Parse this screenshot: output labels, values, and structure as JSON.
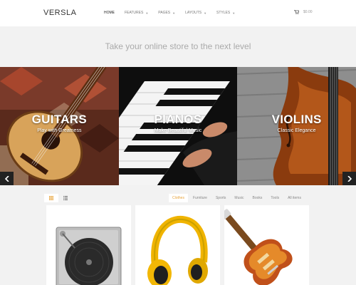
{
  "header": {
    "logo": "VERSLA",
    "nav": [
      {
        "label": "HOME",
        "active": true,
        "dropdown": false
      },
      {
        "label": "FEATURES",
        "active": false,
        "dropdown": true
      },
      {
        "label": "PAGES",
        "active": false,
        "dropdown": true
      },
      {
        "label": "LAYOUTS",
        "active": false,
        "dropdown": true
      },
      {
        "label": "STYLES",
        "active": false,
        "dropdown": true
      }
    ],
    "cart_total": "$0.00"
  },
  "tagline": "Take your online store to the next level",
  "hero": {
    "panels": [
      {
        "title": "GUITARS",
        "subtitle": "Play with Greatness"
      },
      {
        "title": "PIANOS",
        "subtitle": "Make Beautiful Music"
      },
      {
        "title": "VIOLINS",
        "subtitle": "Classic Elegance"
      }
    ]
  },
  "filters": {
    "items": [
      "Clothes",
      "Furniture",
      "Sports",
      "Music",
      "Books",
      "Tools",
      "All items"
    ],
    "active": "Clothes"
  },
  "colors": {
    "accent": "#e8a33b",
    "dark": "#222222"
  }
}
